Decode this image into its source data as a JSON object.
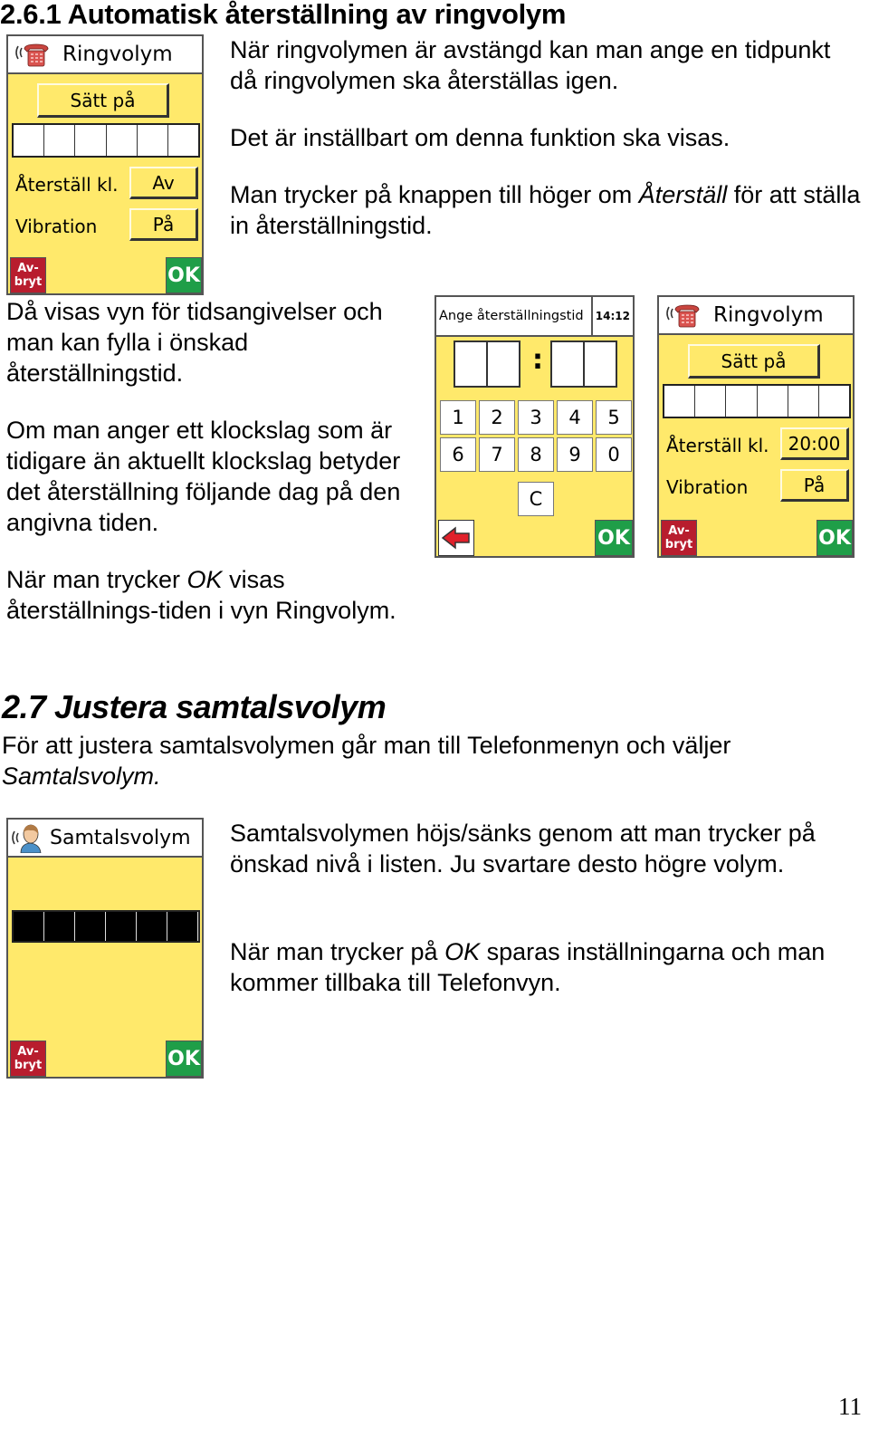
{
  "page": {
    "heading_2_6_1": "2.6.1 Automatisk återställning av ringvolym",
    "heading_2_7": "2.7 Justera samtalsvolym",
    "page_number": "11"
  },
  "text": {
    "p1": "När ringvolymen är avstängd kan man ange en tidpunkt då ringvolymen ska återställas igen.",
    "p2": "Det är inställbart om denna funktion ska visas.",
    "p3_a": "Man trycker på knappen till höger om ",
    "p3_i": "Återställ",
    "p3_b": " för att ställa in återställningstid.",
    "p4": "Då visas vyn för tidsangivelser och man kan fylla i önskad återställningstid.",
    "p5": "Om man anger ett klockslag som är tidigare än aktuellt klockslag betyder det återställning följande dag på den angivna tiden.",
    "p6_a": "När man trycker ",
    "p6_i": "OK",
    "p6_b": " visas återställnings-tiden i vyn Ringvolym.",
    "p7_a": "För att justera samtalsvolymen går man till Telefonmenyn och väljer ",
    "p7_i": "Samtalsvolym.",
    "p8": "Samtalsvolymen höjs/sänks genom att man trycker på önskad nivå i listen. Ju svartare desto högre volym.",
    "p9_a": "När man trycker på ",
    "p9_i": "OK",
    "p9_b": " sparas inställningarna och man kommer tillbaka till Telefonvyn."
  },
  "screens": {
    "ringvolym_off": {
      "icon": "ringing-phone-icon",
      "title": "Ringvolym",
      "toggle_button": "Sätt på",
      "level_segments_filled": 0,
      "level_segments_total": 6,
      "reset_label": "Återställ kl.",
      "reset_value": "Av",
      "vibration_label": "Vibration",
      "vibration_value": "På",
      "cancel": "Av-\nbryt",
      "ok": "OK"
    },
    "time_entry": {
      "title": "Ange återställningstid",
      "clock": "14:12",
      "separator": ":",
      "keys": [
        "1",
        "2",
        "3",
        "4",
        "5",
        "6",
        "7",
        "8",
        "9",
        "0"
      ],
      "clear": "C",
      "back_icon": "left-arrow-icon",
      "ok": "OK"
    },
    "ringvolym_set": {
      "icon": "ringing-phone-icon",
      "title": "Ringvolym",
      "toggle_button": "Sätt på",
      "level_segments_filled": 0,
      "level_segments_total": 6,
      "reset_label": "Återställ kl.",
      "reset_value": "20:00",
      "vibration_label": "Vibration",
      "vibration_value": "På",
      "cancel": "Av-\nbryt",
      "ok": "OK"
    },
    "samtalsvolym": {
      "icon": "speaking-person-icon",
      "title": "Samtalsvolym",
      "level_segments_filled": 6,
      "level_segments_total": 6,
      "cancel": "Av-\nbryt",
      "ok": "OK"
    }
  },
  "colors": {
    "screen_bg": "#ffe96b",
    "cancel_red": "#b81d2e",
    "ok_green": "#1f9e48"
  }
}
